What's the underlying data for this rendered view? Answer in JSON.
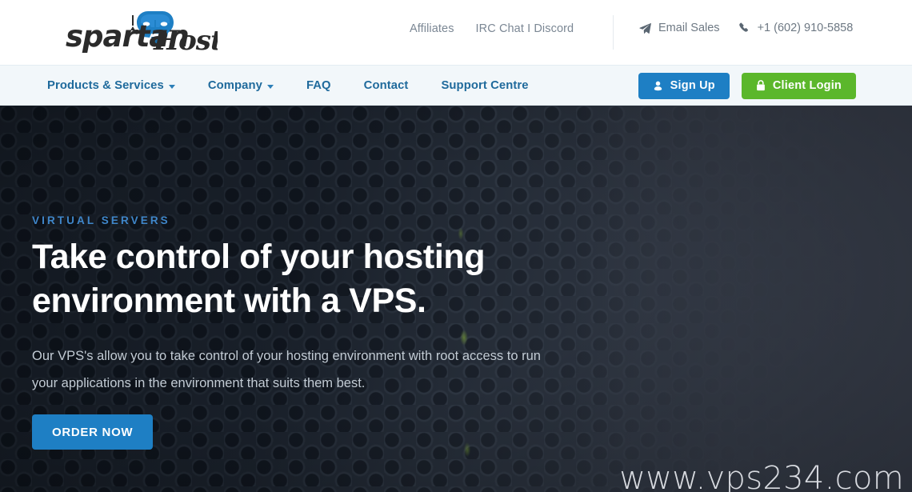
{
  "brand": {
    "logo_text_primary": "spartan",
    "logo_text_secondary": "Host",
    "logo_icon": "spartan-helmet-icon",
    "logo_color": "#1e7fc4",
    "logo_text_color": "#2b2b2b"
  },
  "header": {
    "top_links": [
      {
        "label": "Affiliates",
        "name": "affiliates"
      },
      {
        "label": "IRC Chat I Discord",
        "name": "irc-chat-discord"
      }
    ],
    "contacts": [
      {
        "label": "Email Sales",
        "icon": "paper-plane-icon",
        "name": "email-sales"
      },
      {
        "label": "+1 (602) 910-5858",
        "icon": "phone-icon",
        "name": "phone-number"
      }
    ]
  },
  "nav": {
    "links": [
      {
        "label": "Products & Services",
        "has_caret": true,
        "name": "products-services"
      },
      {
        "label": "Company",
        "has_caret": true,
        "name": "company"
      },
      {
        "label": "FAQ",
        "has_caret": false,
        "name": "faq"
      },
      {
        "label": "Contact",
        "has_caret": false,
        "name": "contact"
      },
      {
        "label": "Support Centre",
        "has_caret": false,
        "name": "support-centre"
      }
    ],
    "signup_label": "Sign Up",
    "signup_icon": "user-icon",
    "signup_color": "#1e7fc4",
    "login_label": "Client Login",
    "login_icon": "lock-icon",
    "login_color": "#5bb72b"
  },
  "hero": {
    "eyebrow": "VIRTUAL SERVERS",
    "eyebrow_color": "#3f86c9",
    "title": "Take control of your hosting environment with a VPS.",
    "subtitle": "Our VPS's allow you to take control of your hosting environment with root access to run your applications in the environment that suits them best.",
    "cta_label": "ORDER NOW",
    "cta_color": "#1e7fc4",
    "background": "perforated-server-grille-dark-blue"
  },
  "watermark": {
    "text": "www.vps234.com"
  }
}
